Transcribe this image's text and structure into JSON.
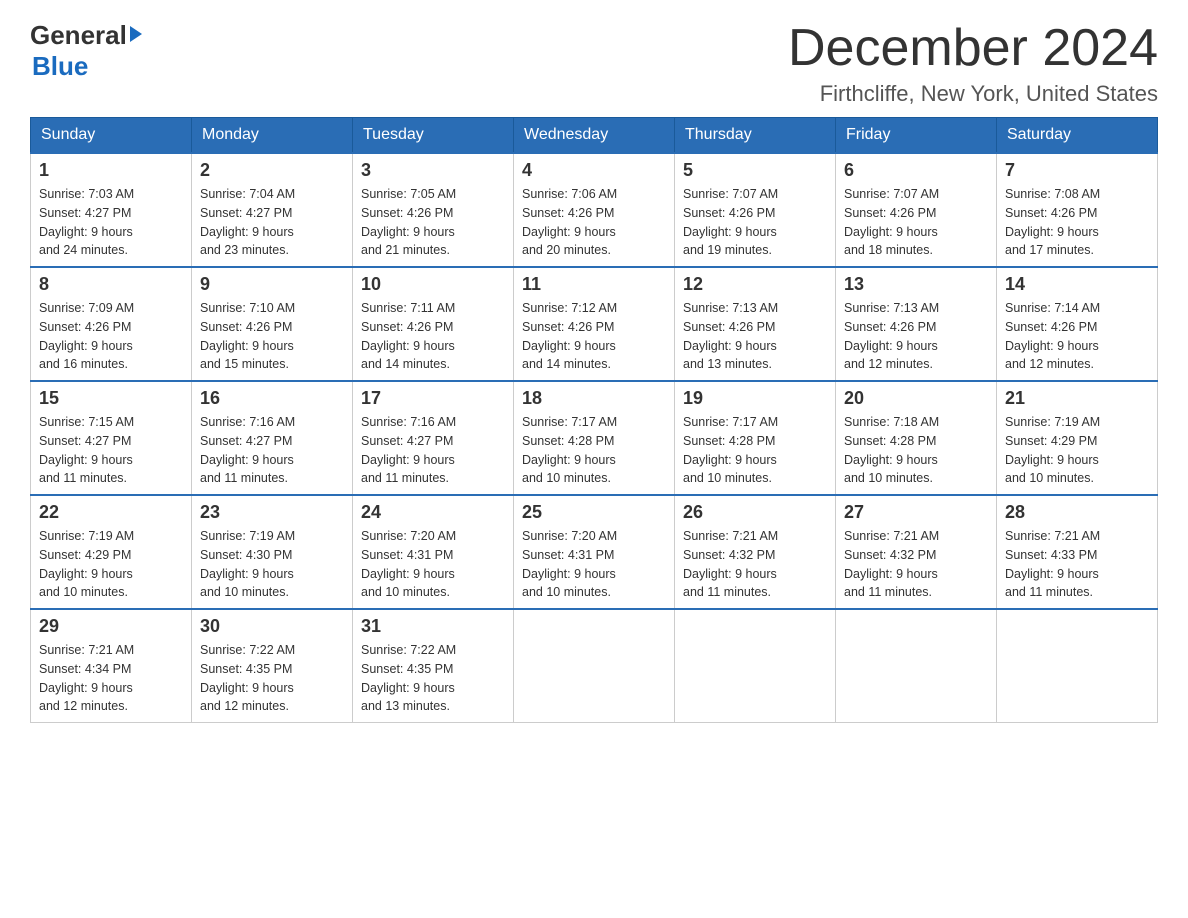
{
  "header": {
    "logo_general": "General",
    "logo_blue": "Blue",
    "title": "December 2024",
    "subtitle": "Firthcliffe, New York, United States"
  },
  "calendar": {
    "days_of_week": [
      "Sunday",
      "Monday",
      "Tuesday",
      "Wednesday",
      "Thursday",
      "Friday",
      "Saturday"
    ],
    "weeks": [
      [
        {
          "day": "1",
          "sunrise": "7:03 AM",
          "sunset": "4:27 PM",
          "daylight": "9 hours and 24 minutes."
        },
        {
          "day": "2",
          "sunrise": "7:04 AM",
          "sunset": "4:27 PM",
          "daylight": "9 hours and 23 minutes."
        },
        {
          "day": "3",
          "sunrise": "7:05 AM",
          "sunset": "4:26 PM",
          "daylight": "9 hours and 21 minutes."
        },
        {
          "day": "4",
          "sunrise": "7:06 AM",
          "sunset": "4:26 PM",
          "daylight": "9 hours and 20 minutes."
        },
        {
          "day": "5",
          "sunrise": "7:07 AM",
          "sunset": "4:26 PM",
          "daylight": "9 hours and 19 minutes."
        },
        {
          "day": "6",
          "sunrise": "7:07 AM",
          "sunset": "4:26 PM",
          "daylight": "9 hours and 18 minutes."
        },
        {
          "day": "7",
          "sunrise": "7:08 AM",
          "sunset": "4:26 PM",
          "daylight": "9 hours and 17 minutes."
        }
      ],
      [
        {
          "day": "8",
          "sunrise": "7:09 AM",
          "sunset": "4:26 PM",
          "daylight": "9 hours and 16 minutes."
        },
        {
          "day": "9",
          "sunrise": "7:10 AM",
          "sunset": "4:26 PM",
          "daylight": "9 hours and 15 minutes."
        },
        {
          "day": "10",
          "sunrise": "7:11 AM",
          "sunset": "4:26 PM",
          "daylight": "9 hours and 14 minutes."
        },
        {
          "day": "11",
          "sunrise": "7:12 AM",
          "sunset": "4:26 PM",
          "daylight": "9 hours and 14 minutes."
        },
        {
          "day": "12",
          "sunrise": "7:13 AM",
          "sunset": "4:26 PM",
          "daylight": "9 hours and 13 minutes."
        },
        {
          "day": "13",
          "sunrise": "7:13 AM",
          "sunset": "4:26 PM",
          "daylight": "9 hours and 12 minutes."
        },
        {
          "day": "14",
          "sunrise": "7:14 AM",
          "sunset": "4:26 PM",
          "daylight": "9 hours and 12 minutes."
        }
      ],
      [
        {
          "day": "15",
          "sunrise": "7:15 AM",
          "sunset": "4:27 PM",
          "daylight": "9 hours and 11 minutes."
        },
        {
          "day": "16",
          "sunrise": "7:16 AM",
          "sunset": "4:27 PM",
          "daylight": "9 hours and 11 minutes."
        },
        {
          "day": "17",
          "sunrise": "7:16 AM",
          "sunset": "4:27 PM",
          "daylight": "9 hours and 11 minutes."
        },
        {
          "day": "18",
          "sunrise": "7:17 AM",
          "sunset": "4:28 PM",
          "daylight": "9 hours and 10 minutes."
        },
        {
          "day": "19",
          "sunrise": "7:17 AM",
          "sunset": "4:28 PM",
          "daylight": "9 hours and 10 minutes."
        },
        {
          "day": "20",
          "sunrise": "7:18 AM",
          "sunset": "4:28 PM",
          "daylight": "9 hours and 10 minutes."
        },
        {
          "day": "21",
          "sunrise": "7:19 AM",
          "sunset": "4:29 PM",
          "daylight": "9 hours and 10 minutes."
        }
      ],
      [
        {
          "day": "22",
          "sunrise": "7:19 AM",
          "sunset": "4:29 PM",
          "daylight": "9 hours and 10 minutes."
        },
        {
          "day": "23",
          "sunrise": "7:19 AM",
          "sunset": "4:30 PM",
          "daylight": "9 hours and 10 minutes."
        },
        {
          "day": "24",
          "sunrise": "7:20 AM",
          "sunset": "4:31 PM",
          "daylight": "9 hours and 10 minutes."
        },
        {
          "day": "25",
          "sunrise": "7:20 AM",
          "sunset": "4:31 PM",
          "daylight": "9 hours and 10 minutes."
        },
        {
          "day": "26",
          "sunrise": "7:21 AM",
          "sunset": "4:32 PM",
          "daylight": "9 hours and 11 minutes."
        },
        {
          "day": "27",
          "sunrise": "7:21 AM",
          "sunset": "4:32 PM",
          "daylight": "9 hours and 11 minutes."
        },
        {
          "day": "28",
          "sunrise": "7:21 AM",
          "sunset": "4:33 PM",
          "daylight": "9 hours and 11 minutes."
        }
      ],
      [
        {
          "day": "29",
          "sunrise": "7:21 AM",
          "sunset": "4:34 PM",
          "daylight": "9 hours and 12 minutes."
        },
        {
          "day": "30",
          "sunrise": "7:22 AM",
          "sunset": "4:35 PM",
          "daylight": "9 hours and 12 minutes."
        },
        {
          "day": "31",
          "sunrise": "7:22 AM",
          "sunset": "4:35 PM",
          "daylight": "9 hours and 13 minutes."
        },
        null,
        null,
        null,
        null
      ]
    ],
    "labels": {
      "sunrise": "Sunrise:",
      "sunset": "Sunset:",
      "daylight": "Daylight:"
    }
  }
}
